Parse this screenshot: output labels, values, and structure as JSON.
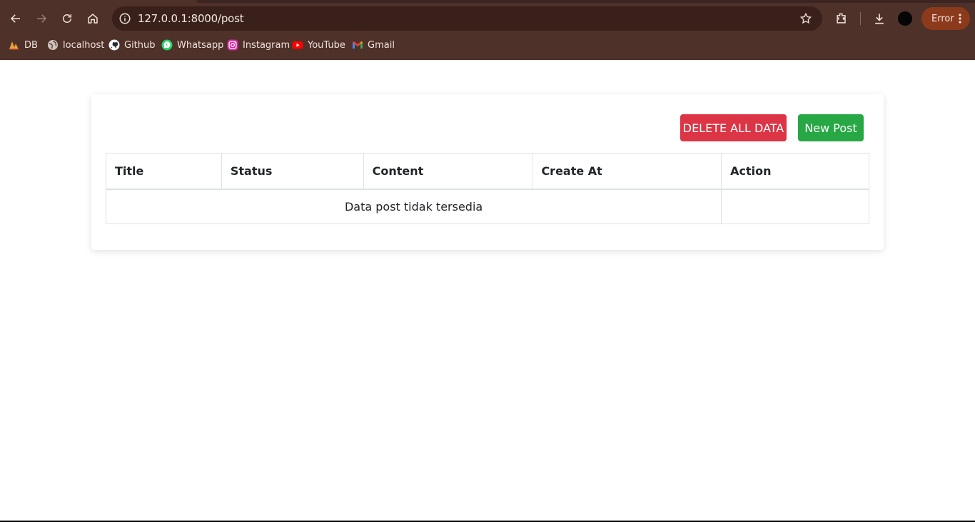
{
  "browser": {
    "url": "127.0.0.1:8000/post",
    "error_label": "Error",
    "accent": "#4e3129",
    "bookmarks": [
      {
        "label": "DB",
        "icon": "db-icon"
      },
      {
        "label": "localhost",
        "icon": "globe-icon"
      },
      {
        "label": "Github",
        "icon": "github-icon"
      },
      {
        "label": "Whatsapp",
        "icon": "whatsapp-icon"
      },
      {
        "label": "Instagram",
        "icon": "instagram-icon"
      },
      {
        "label": "YouTube",
        "icon": "youtube-icon"
      },
      {
        "label": "Gmail",
        "icon": "gmail-icon"
      }
    ]
  },
  "page": {
    "delete_all_label": "DELETE ALL DATA",
    "new_post_label": "New Post",
    "table": {
      "headers": [
        "Title",
        "Status",
        "Content",
        "Create At",
        "Action"
      ],
      "empty_message": "Data post tidak tersedia"
    },
    "colors": {
      "danger": "#dc3545",
      "success": "#28a745"
    }
  }
}
